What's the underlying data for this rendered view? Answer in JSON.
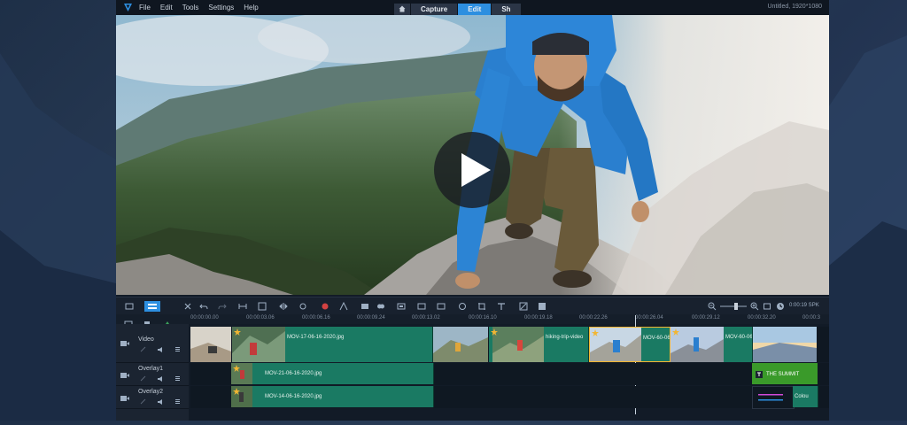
{
  "menu": {
    "logo_icon": "app-logo-icon",
    "items": [
      "File",
      "Edit",
      "Tools",
      "Settings",
      "Help"
    ]
  },
  "modes": {
    "home_icon": "home-icon",
    "items": [
      "Capture",
      "Edit",
      "Sh"
    ],
    "active": "Edit"
  },
  "project": {
    "info": "Untitled, 1920*1080"
  },
  "preview": {
    "play_icon": "play-icon"
  },
  "toolbar": {
    "icons": [
      "storyboard-view-icon",
      "timeline-view-icon",
      "tools-icon",
      "undo-icon",
      "redo-icon",
      "split-icon",
      "trim-icon",
      "flip-icon",
      "stabilize-icon",
      "record-icon",
      "motion-icon",
      "subtitle-icon",
      "mask-icon",
      "multicam-icon",
      "camera-icon",
      "speed-icon",
      "color-icon",
      "crop-icon",
      "text-icon",
      "chapter-icon",
      "effect-icon",
      "zoom-out-icon",
      "zoom-in-icon",
      "fit-icon",
      "clock-icon"
    ],
    "timecode": "0:00:19 SPK"
  },
  "ruler": {
    "labels": [
      "00:00:00.00",
      "00:00:03.06",
      "00:00:06.16",
      "00:00:09.24",
      "00:00:13.02",
      "00:00:16.10",
      "00:00:19.18",
      "00:00:22.26",
      "00:00:26.04",
      "00:00:29.12",
      "00:00:32.20",
      "00:00:3"
    ]
  },
  "tracks": [
    {
      "name": "Video",
      "clips": [
        "MOV-17-06-16-2020.jpg",
        "hiking-trip-video",
        "MOV-60-06",
        "MOV-60-06"
      ]
    },
    {
      "name": "Overlay1",
      "clips": [
        "MOV-21-06-16-2020.jpg"
      ],
      "title_clip": "THE SUMMIT"
    },
    {
      "name": "Overlay2",
      "clips": [
        "MOV-14-06-16-2020.jpg"
      ],
      "extra_clip": "Colou"
    }
  ],
  "colors": {
    "accent": "#2d8fe0",
    "clip": "#1a7a63",
    "title_clip": "#3a9a2a",
    "background": "#121b27"
  }
}
